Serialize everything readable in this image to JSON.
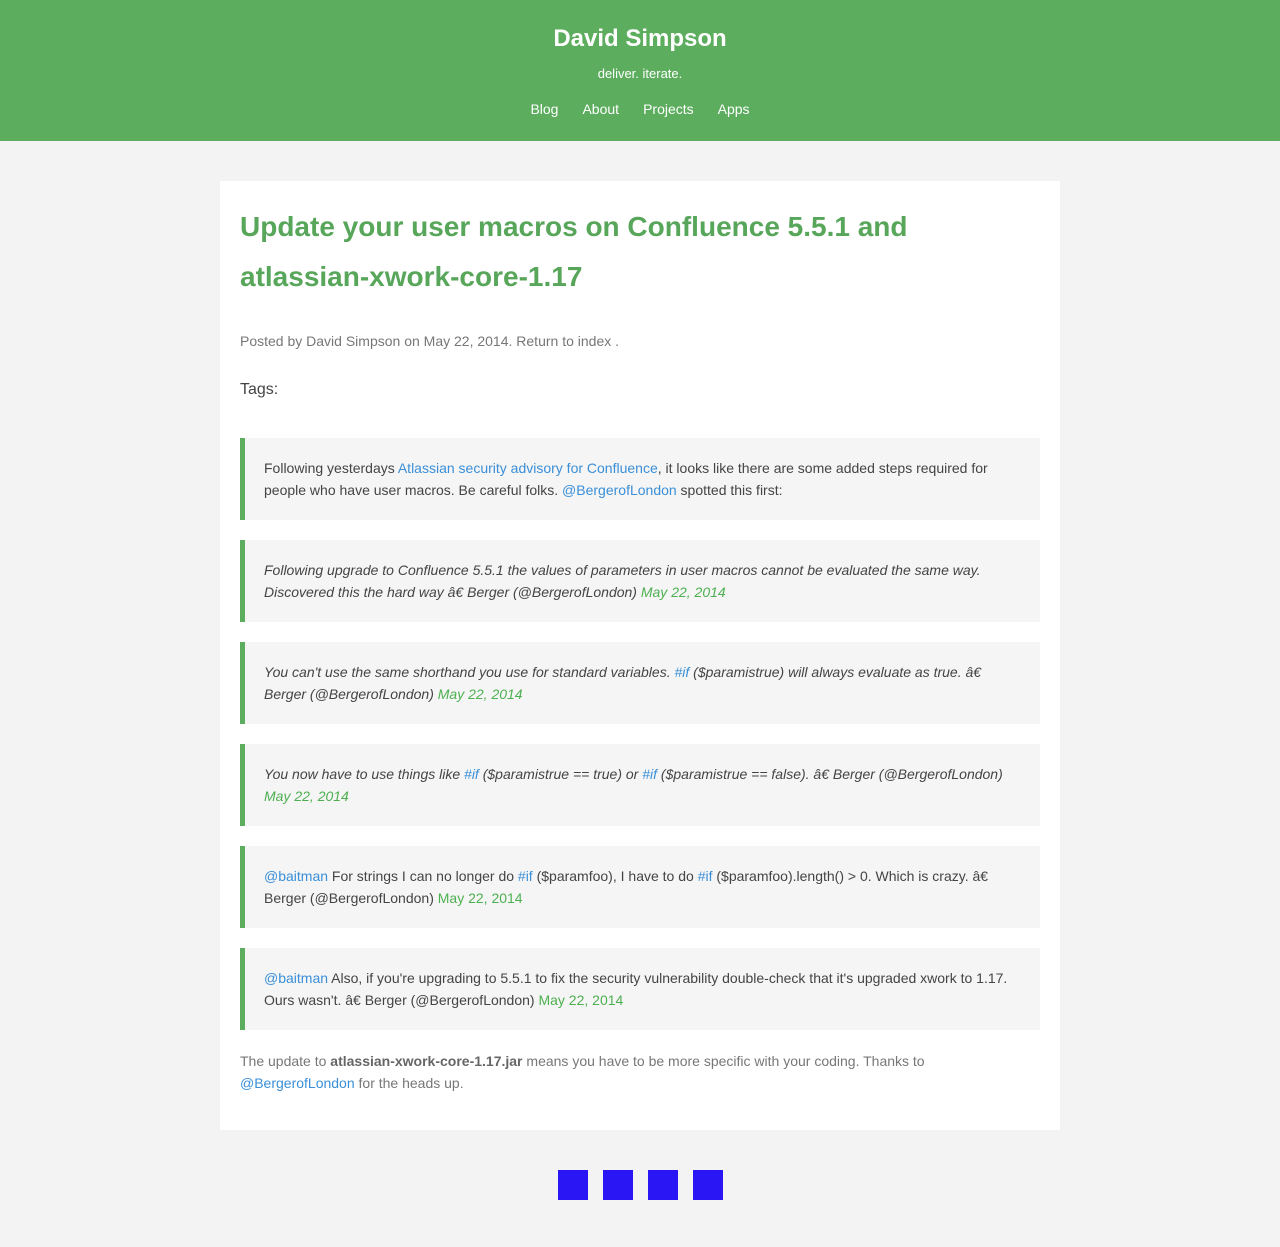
{
  "header": {
    "title": "David Simpson",
    "tagline": "deliver. iterate.",
    "nav": [
      "Blog",
      "About",
      "Projects",
      "Apps"
    ]
  },
  "post": {
    "title": "Update your user macros on Confluence 5.5.1 and atlassian-xwork-core-1.17",
    "meta": {
      "prefix": "Posted by David Simpson on May 22, 2014.",
      "return_link": "Return to index",
      "suffix": "."
    },
    "tags_label": "Tags:",
    "intro": {
      "text1": "Following yesterdays ",
      "link1": "Atlassian security advisory for Confluence",
      "text2": ", it looks like there are some added steps required for people who have user macros. Be careful folks. ",
      "link2": "@BergerofLondon",
      "text3": " spotted this first:"
    },
    "tweet1": {
      "text": "Following upgrade to Confluence 5.5.1 the values of parameters in user macros cannot be evaluated the same way. Discovered this the hard way â€     Berger (@BergerofLondon) ",
      "date": "May 22, 2014"
    },
    "tweet2": {
      "text1": "You can't use the same shorthand you use for standard variables. ",
      "hashtag": "#if",
      "text2": " ($paramistrue) will always evaluate as true. â€ Berger (@BergerofLondon) ",
      "date": "May 22, 2014"
    },
    "tweet3": {
      "text1": "You now have to use things like ",
      "hashtag1": "#if",
      "text2": " ($paramistrue == true) or ",
      "hashtag2": "#if",
      "text3": " ($paramistrue == false). â€     Berger (@BergerofLondon) ",
      "date": "May 22, 2014"
    },
    "tweet4": {
      "mention": "@baitman",
      "text1": " For strings I can no longer do ",
      "hashtag1": "#if",
      "text2": " ($paramfoo), I have to do ",
      "hashtag2": "#if",
      "text3": " ($paramfoo).length() > 0. Which is crazy. â€ Berger (@BergerofLondon) ",
      "date": "May 22, 2014"
    },
    "tweet5": {
      "mention": "@baitman",
      "text1": " Also, if you're upgrading to 5.5.1 to fix the security vulnerability double-check that it's upgraded xwork to 1.17. Ours wasn't. â€     Berger (@BergerofLondon) ",
      "date": "May 22, 2014"
    },
    "closing": {
      "text1": "The update to ",
      "bold": "atlassian-xwork-core-1.17.jar",
      "text2": " means you have to be more specific with your coding. Thanks to ",
      "link": "@BergerofLondon",
      "text3": " for the heads up."
    }
  },
  "footer": {
    "icons": [
      "social-icon-1",
      "social-icon-2",
      "social-icon-3",
      "social-icon-4"
    ],
    "icon_color": "#2a16f5"
  },
  "colors": {
    "header_bg": "#5cad5e",
    "title": "#57a65a",
    "link": "#3a8fd8",
    "date": "#4cb050",
    "page_bg": "#f3f3f3"
  }
}
